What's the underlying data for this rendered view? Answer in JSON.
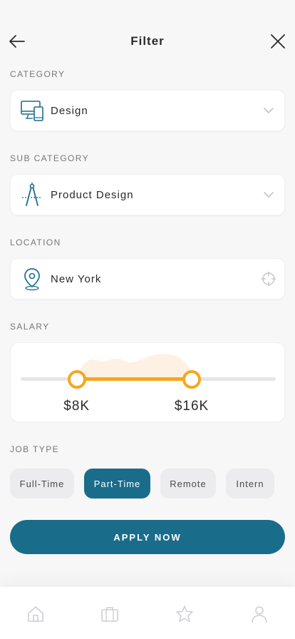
{
  "header": {
    "title": "Filter",
    "back_icon": "arrow-left-icon",
    "close_icon": "close-icon"
  },
  "category": {
    "label": "CATEGORY",
    "value": "Design",
    "icon": "devices-icon"
  },
  "sub_category": {
    "label": "SUB CATEGORY",
    "value": "Product Design",
    "icon": "drafting-compass-icon"
  },
  "location": {
    "label": "LOCATION",
    "value": "New York",
    "icon": "map-pin-icon",
    "action_icon": "crosshair-icon"
  },
  "salary": {
    "label": "SALARY",
    "min_label": "$8K",
    "max_label": "$16K",
    "min_fraction": 0.22,
    "max_fraction": 0.67
  },
  "job_type": {
    "label": "JOB TYPE",
    "options": [
      {
        "label": "Full-Time",
        "active": false
      },
      {
        "label": "Part-Time",
        "active": true
      },
      {
        "label": "Remote",
        "active": false
      },
      {
        "label": "Intern",
        "active": false
      }
    ]
  },
  "apply_button": "APPLY NOW",
  "nav": [
    "home-icon",
    "briefcase-icon",
    "star-icon",
    "profile-icon"
  ],
  "colors": {
    "primary": "#1a6d8a",
    "accent": "#f3a81e",
    "background": "#f7f7f8"
  }
}
